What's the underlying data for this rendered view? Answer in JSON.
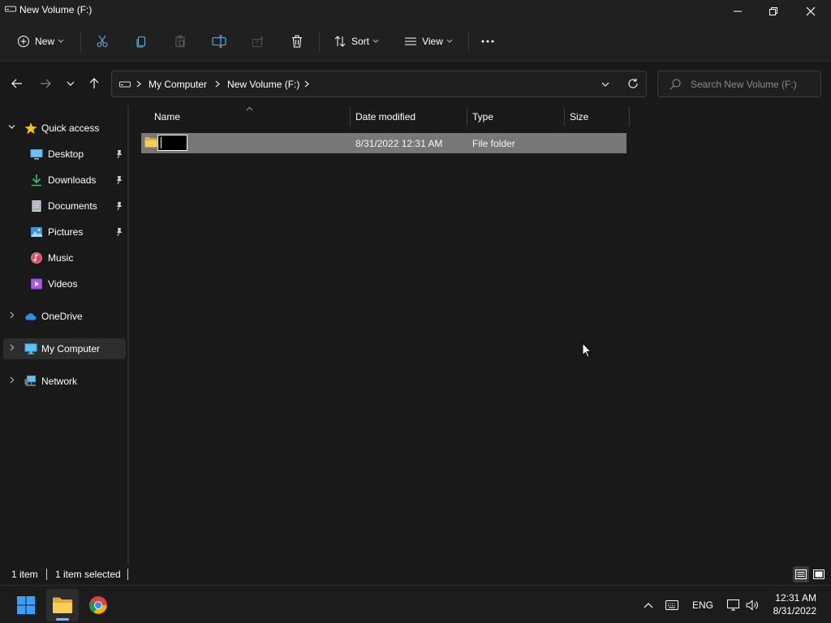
{
  "window": {
    "title": "New Volume (F:)"
  },
  "toolbar": {
    "new_label": "New",
    "sort_label": "Sort",
    "view_label": "View"
  },
  "address": {
    "crumbs": [
      "My Computer",
      "New Volume (F:)"
    ],
    "search_placeholder": "Search New Volume (F:)"
  },
  "nav": {
    "quick_access": "Quick access",
    "pinned": [
      {
        "label": "Desktop",
        "icon": "desktop-icon"
      },
      {
        "label": "Downloads",
        "icon": "downloads-icon"
      },
      {
        "label": "Documents",
        "icon": "documents-icon"
      },
      {
        "label": "Pictures",
        "icon": "pictures-icon"
      },
      {
        "label": "Music",
        "icon": "music-icon"
      },
      {
        "label": "Videos",
        "icon": "videos-icon"
      }
    ],
    "onedrive": "OneDrive",
    "my_computer": "My Computer",
    "network": "Network"
  },
  "columns": {
    "name": "Name",
    "date_modified": "Date modified",
    "type": "Type",
    "size": "Size"
  },
  "files": [
    {
      "name": "",
      "date_modified": "8/31/2022 12:31 AM",
      "type": "File folder",
      "size": ""
    }
  ],
  "status": {
    "count": "1 item",
    "selected": "1 item selected"
  },
  "taskbar": {
    "language": "ENG",
    "time": "12:31 AM",
    "date": "8/31/2022"
  },
  "colors": {
    "background": "#191919",
    "chrome": "#202020",
    "selection": "#777777",
    "folder": "#f0c75e",
    "accent": "#4cc2ff"
  }
}
